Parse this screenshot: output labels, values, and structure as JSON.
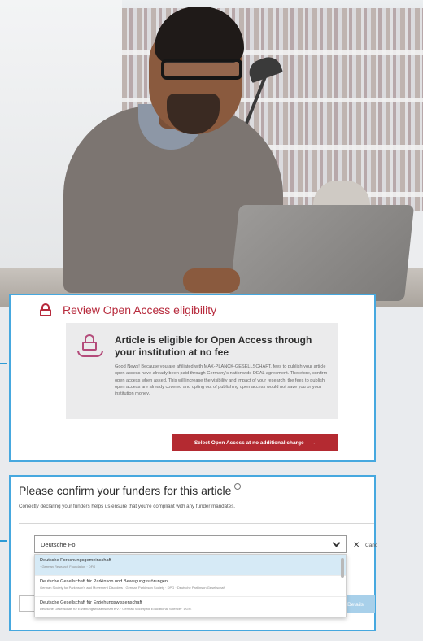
{
  "eligibility": {
    "heading": "Review Open Access eligibility",
    "box_title": "Article is eligible for Open Access through your institution at no fee",
    "box_body": "Good News! Because you are affiliated with MAX-PLANCK-GESELLSCHAFT, fees to publish your article open access have already been paid through Germany's nationwide DEAL agreement. Therefore, confirm open access when asked. This will increase the visibility and impact of your research, the fees to publish open access are already covered and opting out of publishing open access would not save you or your institution money.",
    "cta_label": "Select Open Access at no additional charge",
    "cta_icon": "arrow-right-icon",
    "heading_icon": "lock-icon",
    "box_icon": "open-access-hand-icon",
    "accent_color": "#b42a31"
  },
  "funders": {
    "heading": "Please confirm your funders for this article",
    "description": "Correctly declaring your funders helps us ensure that you're compliant with any funder mandates.",
    "search_value": "Deutsche Fo|",
    "cancel_label": "Canc",
    "dropdown": [
      {
        "name": "Deutsche Forschungsgemeinschaft",
        "meta": " · German Research Foundation · DFG"
      },
      {
        "name": "Deutsche Gesellschaft für Parkinson und Bewegungsstörungen",
        "meta": "German Society for Parkinson's and Movement Disorders · German Parkinson Society · DPG · Deutsche Parkinson Gesellschaft"
      },
      {
        "name": "Deutsche Gesellschaft für Erziehungswissenschaft",
        "meta": "Deutsche Gesellschaft für Erziehungswissenschaft e.V. · German Society for Educational Science · DGfE"
      }
    ],
    "details_label": "Details",
    "frame_color": "#46a8df"
  }
}
